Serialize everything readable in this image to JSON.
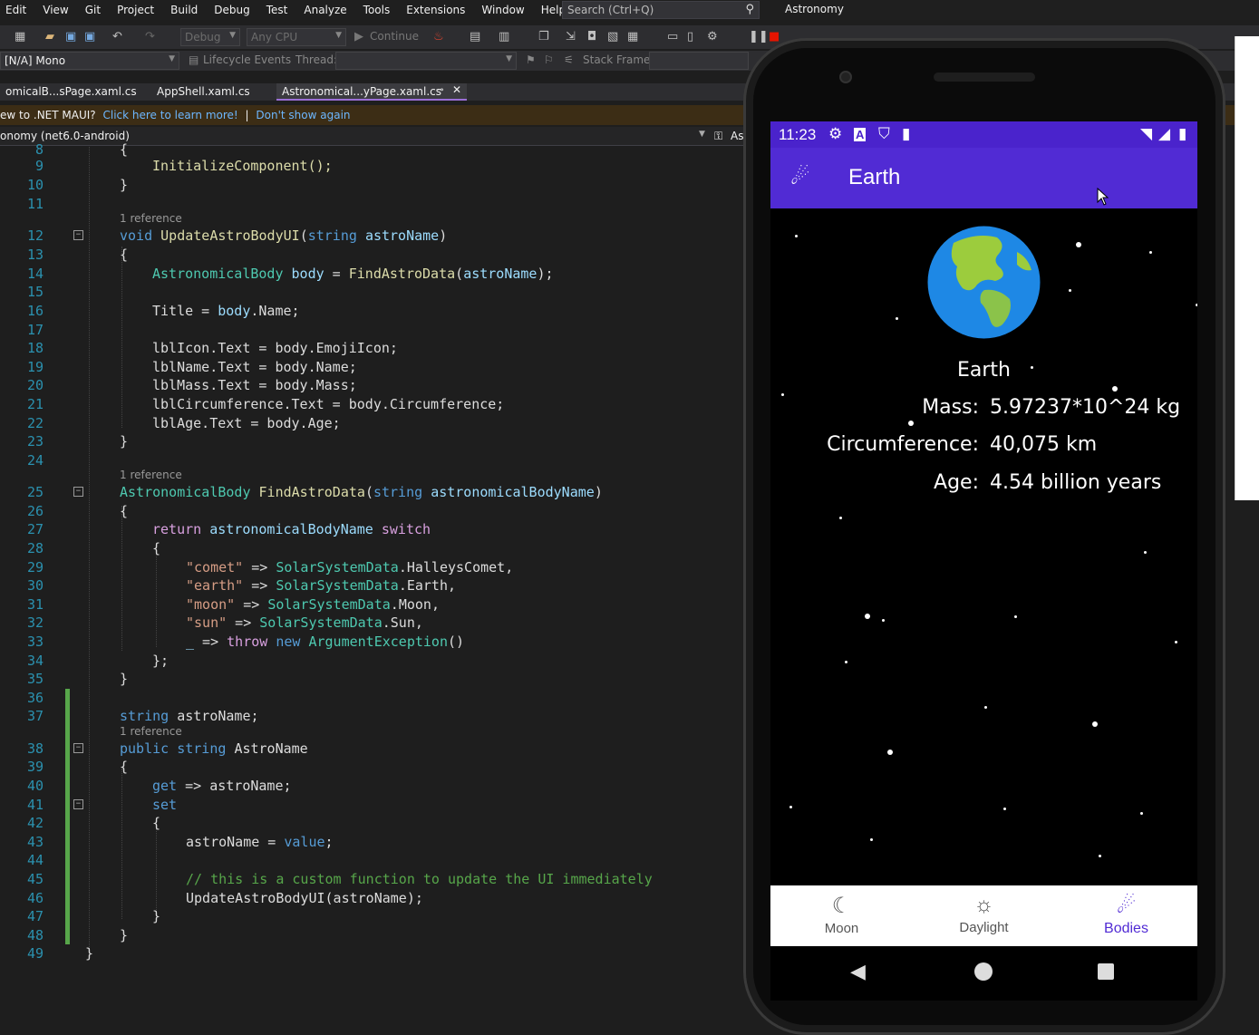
{
  "menu": [
    "Edit",
    "View",
    "Git",
    "Project",
    "Build",
    "Debug",
    "Test",
    "Analyze",
    "Tools",
    "Extensions",
    "Window",
    "Help"
  ],
  "search": {
    "placeholder": "Search (Ctrl+Q)"
  },
  "app_title": "Astronomy",
  "toolbar": {
    "config": "Debug",
    "platform": "Any CPU",
    "continue": "Continue",
    "runtime": "[N/A] Mono",
    "lifecycle": "Lifecycle Events",
    "thread": "Thread:",
    "stack": "Stack Frame:"
  },
  "tabs": [
    "omicalB...sPage.xaml.cs",
    "AppShell.xaml.cs",
    "Astronomical...yPage.xaml.cs"
  ],
  "infobar": {
    "text": "ew to .NET MAUI?",
    "link1": "Click here to learn more!",
    "sep": "|",
    "link2": "Don't show again"
  },
  "navbar": {
    "project": "onomy (net6.0-android)",
    "member": "As"
  },
  "code": {
    "refs": [
      "1 reference",
      "1 reference",
      "1 reference"
    ],
    "lines": {
      "8": "{",
      "9": "InitializeComponent();",
      "10": "}",
      "12a": "void",
      "12b": "UpdateAstroBodyUI",
      "12c": "string",
      "12d": "astroName",
      "14a": "AstronomicalBody",
      "14b": "body",
      "14c": "FindAstroData",
      "14d": "astroName",
      "16a": "Title",
      "16b": "body",
      "16c": "Name",
      "18": "lblIcon.Text = body.EmojiIcon;",
      "19": "lblName.Text = body.Name;",
      "20": "lblMass.Text = body.Mass;",
      "21": "lblCircumference.Text = body.Circumference;",
      "22": "lblAge.Text = body.Age;",
      "25a": "AstronomicalBody",
      "25b": "FindAstroData",
      "25c": "string",
      "25d": "astronomicalBodyName",
      "27a": "return",
      "27b": "astronomicalBodyName",
      "27c": "switch",
      "29a": "\"comet\"",
      "29b": "SolarSystemData",
      "29c": "HalleysComet",
      "30a": "\"earth\"",
      "30b": "SolarSystemData",
      "30c": "Earth",
      "31a": "\"moon\"",
      "31b": "SolarSystemData",
      "31c": "Moon",
      "32a": "\"sun\"",
      "32b": "SolarSystemData",
      "32c": "Sun",
      "33a": "_",
      "33b": "throw",
      "33c": "new",
      "33d": "ArgumentException",
      "37a": "string",
      "37b": "astroName",
      "38a": "public",
      "38b": "string",
      "38c": "AstroName",
      "40a": "get",
      "40b": "astroName",
      "41": "set",
      "43a": "astroName",
      "43b": "value",
      "45": "// this is a custom function to update the UI immediately",
      "46": "UpdateAstroBodyUI(astroName);"
    },
    "line_numbers": [
      "8",
      "9",
      "10",
      "11",
      "12",
      "13",
      "14",
      "15",
      "16",
      "17",
      "18",
      "19",
      "20",
      "21",
      "22",
      "23",
      "24",
      "25",
      "26",
      "27",
      "28",
      "29",
      "30",
      "31",
      "32",
      "33",
      "34",
      "35",
      "36",
      "37",
      "38",
      "39",
      "40",
      "41",
      "42",
      "43",
      "44",
      "45",
      "46",
      "47",
      "48",
      "49"
    ]
  },
  "phone": {
    "time": "11:23",
    "title": "Earth",
    "body_name": "Earth",
    "mass_label": "Mass:",
    "mass_value": "5.97237*10^24 kg",
    "circ_label": "Circumference:",
    "circ_value": "40,075 km",
    "age_label": "Age:",
    "age_value": "4.54 billion years",
    "nav": [
      {
        "label": "Moon",
        "icon": "moon-icon"
      },
      {
        "label": "Daylight",
        "icon": "sun-icon"
      },
      {
        "label": "Bodies",
        "icon": "comet-icon"
      }
    ],
    "accent": "#512BD4"
  }
}
